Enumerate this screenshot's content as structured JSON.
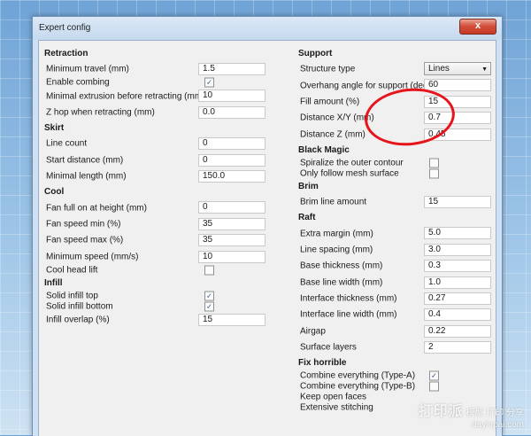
{
  "window": {
    "title": "Expert config",
    "close_label": "x"
  },
  "left": {
    "retraction": {
      "title": "Retraction",
      "rows": [
        {
          "label": "Minimum travel (mm)",
          "value": "1.5"
        },
        {
          "label": "Enable combing",
          "checked": true
        },
        {
          "label": "Minimal extrusion before retracting (mm)",
          "value": "10"
        },
        {
          "label": "Z hop when retracting (mm)",
          "value": "0.0"
        }
      ]
    },
    "skirt": {
      "title": "Skirt",
      "rows": [
        {
          "label": "Line count",
          "value": "0"
        },
        {
          "label": "Start distance (mm)",
          "value": "0"
        },
        {
          "label": "Minimal length (mm)",
          "value": "150.0"
        }
      ]
    },
    "cool": {
      "title": "Cool",
      "rows": [
        {
          "label": "Fan full on at height (mm)",
          "value": "0"
        },
        {
          "label": "Fan speed min (%)",
          "value": "35"
        },
        {
          "label": "Fan speed max (%)",
          "value": "35"
        },
        {
          "label": "Minimum speed (mm/s)",
          "value": "10"
        },
        {
          "label": "Cool head lift",
          "checked": false
        }
      ]
    },
    "infill": {
      "title": "Infill",
      "rows": [
        {
          "label": "Solid infill top",
          "checked": true
        },
        {
          "label": "Solid infill bottom",
          "checked": true
        },
        {
          "label": "Infill overlap (%)",
          "value": "15"
        }
      ]
    }
  },
  "right": {
    "support": {
      "title": "Support",
      "rows": [
        {
          "label": "Structure type",
          "select": "Lines"
        },
        {
          "label": "Overhang angle for support (deg)",
          "value": "60"
        },
        {
          "label": "Fill amount (%)",
          "value": "15"
        },
        {
          "label": "Distance X/Y (mm)",
          "value": "0.7"
        },
        {
          "label": "Distance Z (mm)",
          "value": "0.45"
        }
      ]
    },
    "black_magic": {
      "title": "Black Magic",
      "rows": [
        {
          "label": "Spiralize the outer contour",
          "checked": false
        },
        {
          "label": "Only follow mesh surface",
          "checked": false
        }
      ]
    },
    "brim": {
      "title": "Brim",
      "rows": [
        {
          "label": "Brim line amount",
          "value": "15"
        }
      ]
    },
    "raft": {
      "title": "Raft",
      "rows": [
        {
          "label": "Extra margin (mm)",
          "value": "5.0"
        },
        {
          "label": "Line spacing (mm)",
          "value": "3.0"
        },
        {
          "label": "Base thickness (mm)",
          "value": "0.3"
        },
        {
          "label": "Base line width (mm)",
          "value": "1.0"
        },
        {
          "label": "Interface thickness (mm)",
          "value": "0.27"
        },
        {
          "label": "Interface line width (mm)",
          "value": "0.4"
        },
        {
          "label": "Airgap",
          "value": "0.22"
        },
        {
          "label": "Surface layers",
          "value": "2"
        }
      ]
    },
    "fix_horrible": {
      "title": "Fix horrible",
      "rows": [
        {
          "label": "Combine everything (Type-A)",
          "checked": true
        },
        {
          "label": "Combine everything (Type-B)",
          "checked": false
        },
        {
          "label": "Keep open faces"
        },
        {
          "label": "Extensive stitching"
        }
      ]
    }
  },
  "watermark": {
    "logo": "打印派",
    "text": "模型 打印 分享",
    "url": "dayinpai.com"
  }
}
